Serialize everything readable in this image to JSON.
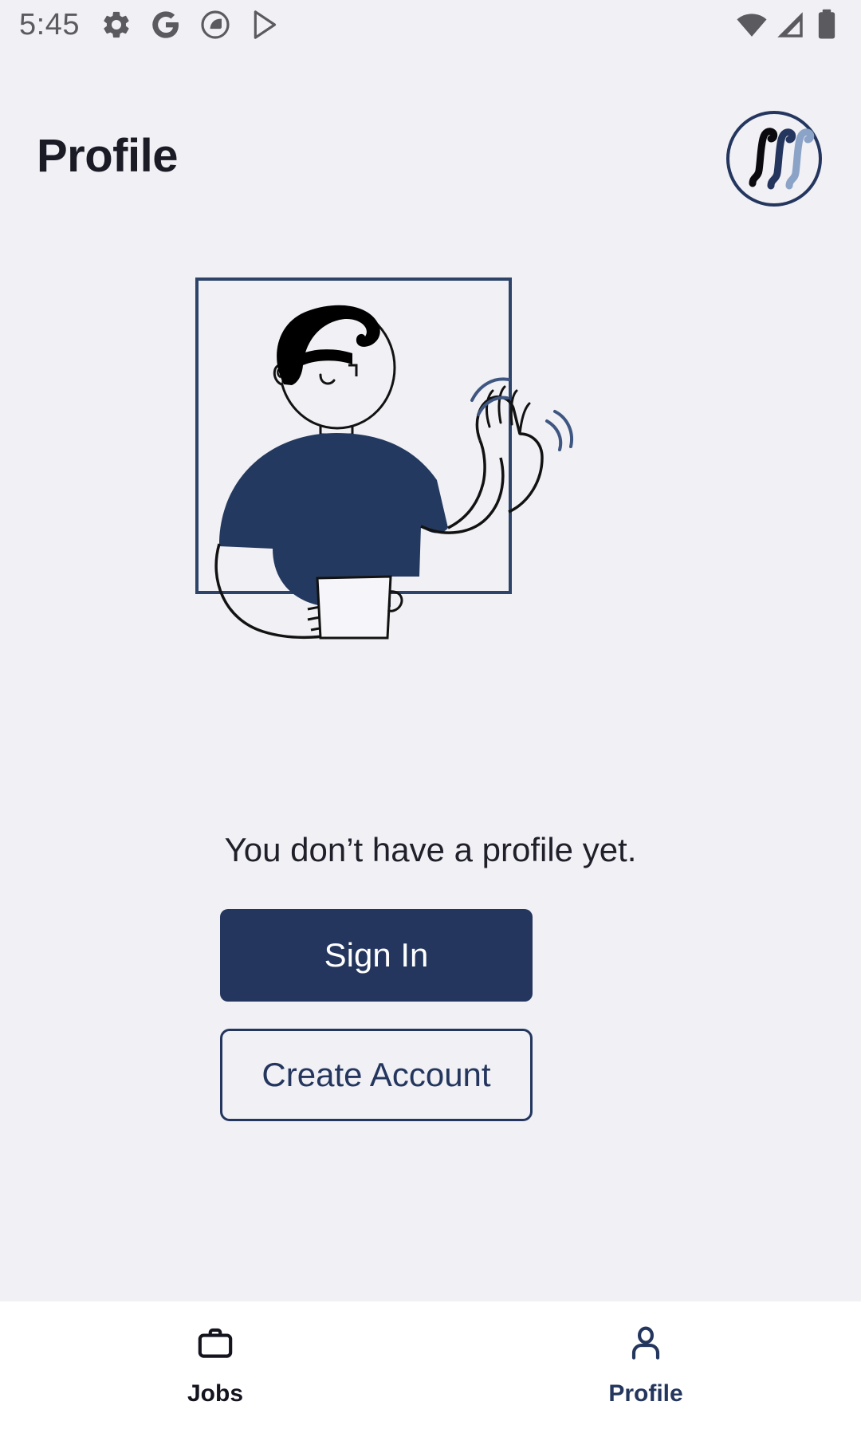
{
  "status_bar": {
    "time": "5:45",
    "left_icons": [
      "gear-icon",
      "google-g-icon",
      "app-circle-icon",
      "play-arrow-icon"
    ],
    "right_icons": [
      "wifi-icon",
      "cellular-signal-icon",
      "battery-icon"
    ]
  },
  "header": {
    "title": "Profile",
    "logo_name": "triple-integral-logo",
    "logo_colors": {
      "ring": "#24365E",
      "stroke_1": "#0A0A0F",
      "stroke_2": "#24365E",
      "stroke_3": "#8BA3C7"
    }
  },
  "illustration": {
    "name": "waving-person-with-mug-illustration",
    "frame_color": "#2D4368",
    "shirt_color": "#24395F",
    "hair_color": "#000000",
    "line_color": "#121212",
    "motion_arc_color": "#3E5680",
    "background": "#F0F0F5"
  },
  "main": {
    "empty_message": "You don’t have a profile yet.",
    "sign_in_label": "Sign In",
    "create_account_label": "Create Account"
  },
  "colors": {
    "page_background": "#F0F0F5",
    "navy": "#24365E",
    "nav_background": "#FFFFFF",
    "title_color": "#1B1B26",
    "body_text": "#20202B",
    "status_icon": "#5B5B5F"
  },
  "bottom_nav": {
    "items": [
      {
        "label": "Jobs",
        "icon": "briefcase-icon",
        "active": false
      },
      {
        "label": "Profile",
        "icon": "person-icon",
        "active": true
      }
    ]
  }
}
